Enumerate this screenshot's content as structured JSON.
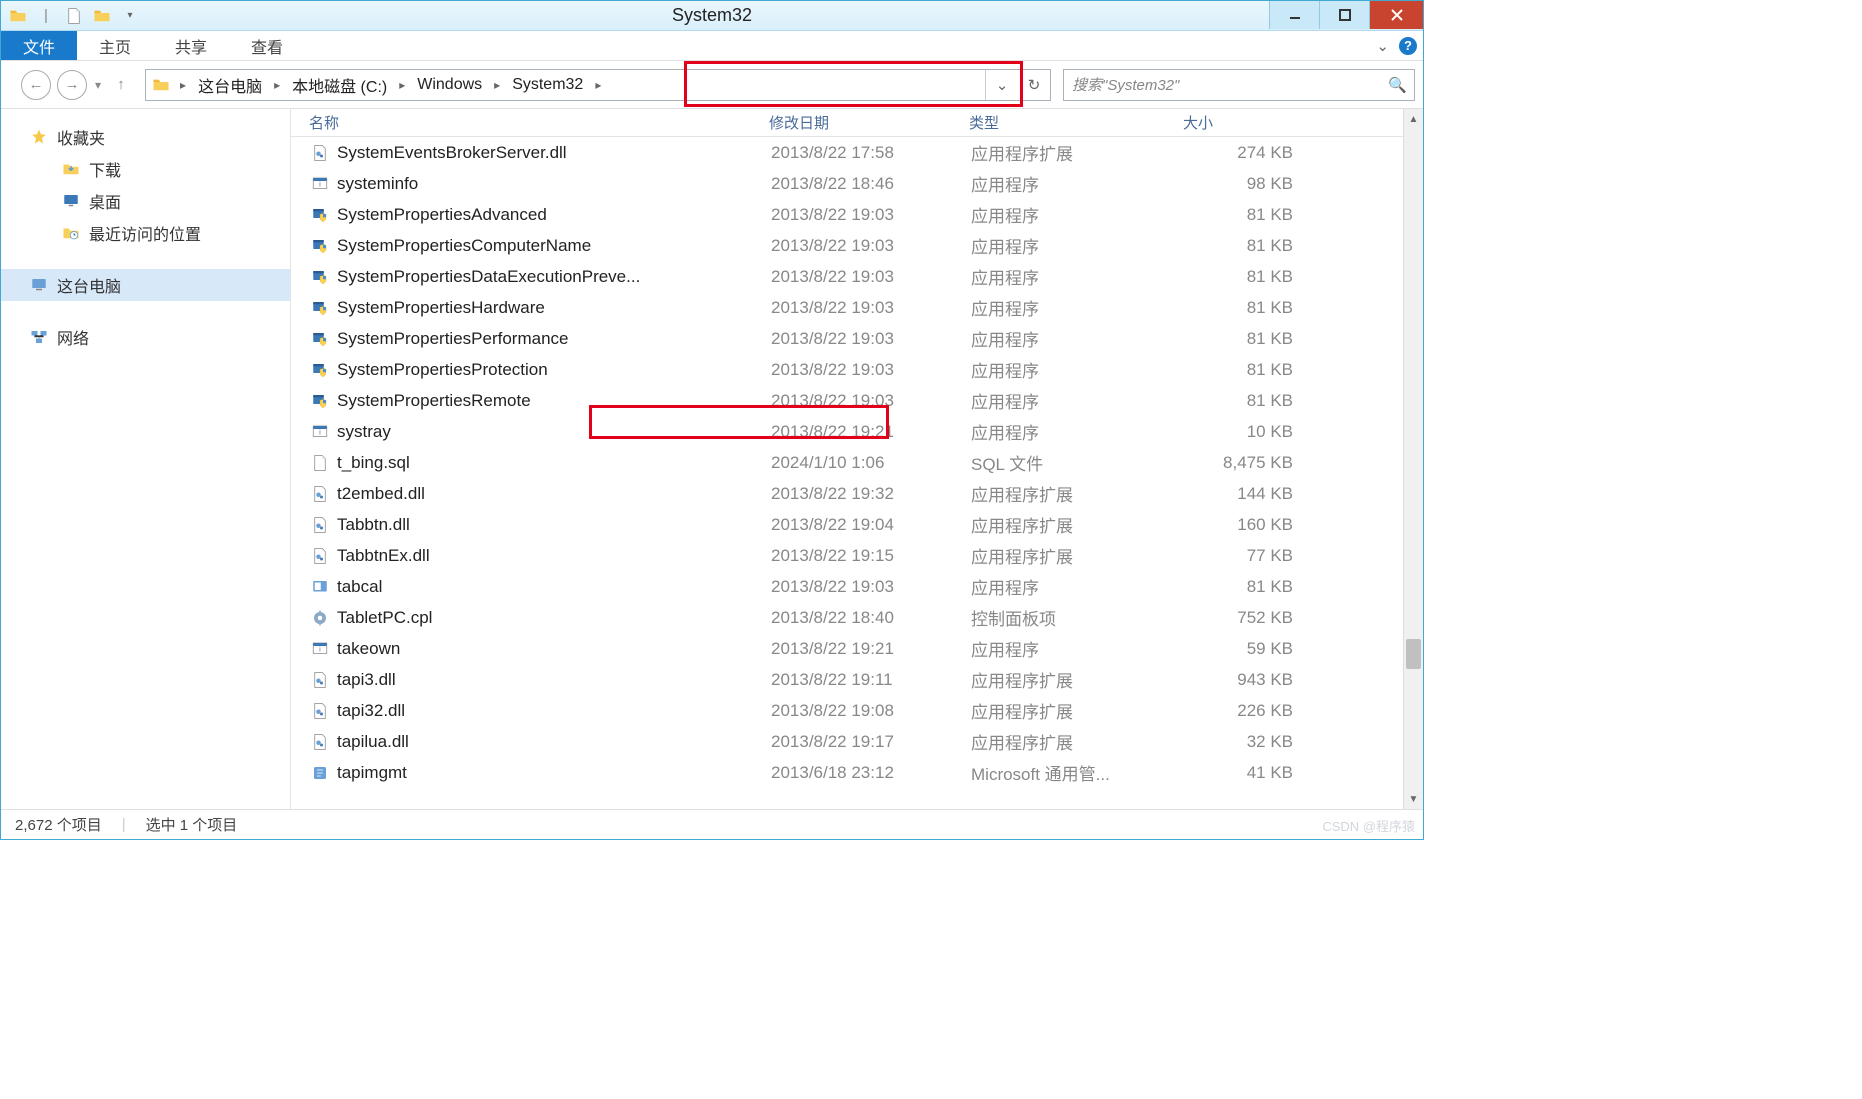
{
  "window": {
    "title": "System32"
  },
  "ribbon": {
    "file": "文件",
    "tabs": [
      "主页",
      "共享",
      "查看"
    ]
  },
  "breadcrumb": [
    "这台电脑",
    "本地磁盘 (C:)",
    "Windows",
    "System32"
  ],
  "search": {
    "placeholder": "搜索\"System32\""
  },
  "sidebar": {
    "favorites": {
      "label": "收藏夹",
      "items": [
        "下载",
        "桌面",
        "最近访问的位置"
      ]
    },
    "computer": {
      "label": "这台电脑"
    },
    "network": {
      "label": "网络"
    }
  },
  "columns": {
    "name": "名称",
    "date": "修改日期",
    "type": "类型",
    "size": "大小"
  },
  "files": [
    {
      "icon": "dll",
      "name": "SystemEventsBrokerServer.dll",
      "date": "2013/8/22 17:58",
      "type": "应用程序扩展",
      "size": "274 KB"
    },
    {
      "icon": "exe-info",
      "name": "systeminfo",
      "date": "2013/8/22 18:46",
      "type": "应用程序",
      "size": "98 KB"
    },
    {
      "icon": "exe-shield",
      "name": "SystemPropertiesAdvanced",
      "date": "2013/8/22 19:03",
      "type": "应用程序",
      "size": "81 KB"
    },
    {
      "icon": "exe-shield",
      "name": "SystemPropertiesComputerName",
      "date": "2013/8/22 19:03",
      "type": "应用程序",
      "size": "81 KB"
    },
    {
      "icon": "exe-shield",
      "name": "SystemPropertiesDataExecutionPreve...",
      "date": "2013/8/22 19:03",
      "type": "应用程序",
      "size": "81 KB"
    },
    {
      "icon": "exe-shield",
      "name": "SystemPropertiesHardware",
      "date": "2013/8/22 19:03",
      "type": "应用程序",
      "size": "81 KB"
    },
    {
      "icon": "exe-shield",
      "name": "SystemPropertiesPerformance",
      "date": "2013/8/22 19:03",
      "type": "应用程序",
      "size": "81 KB"
    },
    {
      "icon": "exe-shield",
      "name": "SystemPropertiesProtection",
      "date": "2013/8/22 19:03",
      "type": "应用程序",
      "size": "81 KB"
    },
    {
      "icon": "exe-shield",
      "name": "SystemPropertiesRemote",
      "date": "2013/8/22 19:03",
      "type": "应用程序",
      "size": "81 KB"
    },
    {
      "icon": "exe-info",
      "name": "systray",
      "date": "2013/8/22 19:21",
      "type": "应用程序",
      "size": "10 KB"
    },
    {
      "icon": "file",
      "name": "t_bing.sql",
      "date": "2024/1/10 1:06",
      "type": "SQL 文件",
      "size": "8,475 KB"
    },
    {
      "icon": "dll",
      "name": "t2embed.dll",
      "date": "2013/8/22 19:32",
      "type": "应用程序扩展",
      "size": "144 KB"
    },
    {
      "icon": "dll",
      "name": "Tabbtn.dll",
      "date": "2013/8/22 19:04",
      "type": "应用程序扩展",
      "size": "160 KB"
    },
    {
      "icon": "dll",
      "name": "TabbtnEx.dll",
      "date": "2013/8/22 19:15",
      "type": "应用程序扩展",
      "size": "77 KB"
    },
    {
      "icon": "exe-tab",
      "name": "tabcal",
      "date": "2013/8/22 19:03",
      "type": "应用程序",
      "size": "81 KB"
    },
    {
      "icon": "cpl",
      "name": "TabletPC.cpl",
      "date": "2013/8/22 18:40",
      "type": "控制面板项",
      "size": "752 KB"
    },
    {
      "icon": "exe-info",
      "name": "takeown",
      "date": "2013/8/22 19:21",
      "type": "应用程序",
      "size": "59 KB"
    },
    {
      "icon": "dll",
      "name": "tapi3.dll",
      "date": "2013/8/22 19:11",
      "type": "应用程序扩展",
      "size": "943 KB"
    },
    {
      "icon": "dll",
      "name": "tapi32.dll",
      "date": "2013/8/22 19:08",
      "type": "应用程序扩展",
      "size": "226 KB"
    },
    {
      "icon": "dll",
      "name": "tapilua.dll",
      "date": "2013/8/22 19:17",
      "type": "应用程序扩展",
      "size": "32 KB"
    },
    {
      "icon": "exe-misc",
      "name": "tapimgmt",
      "date": "2013/6/18 23:12",
      "type": "Microsoft 通用管...",
      "size": "41 KB"
    }
  ],
  "status": {
    "items": "2,672 个项目",
    "selected": "选中 1 个项目"
  },
  "watermark": "CSDN @程序猿"
}
